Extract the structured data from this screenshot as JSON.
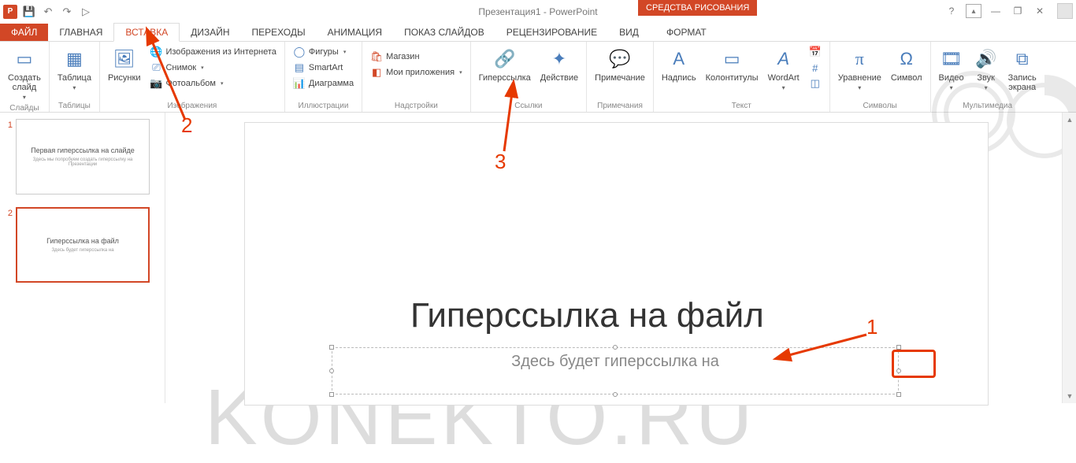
{
  "title": "Презентация1 - PowerPoint",
  "context_tab": "СРЕДСТВА РИСОВАНИЯ",
  "tabs": {
    "file": "ФАЙЛ",
    "home": "ГЛАВНАЯ",
    "insert": "ВСТАВКА",
    "design": "ДИЗАЙН",
    "transitions": "ПЕРЕХОДЫ",
    "animation": "АНИМАЦИЯ",
    "slideshow": "ПОКАЗ СЛАЙДОВ",
    "review": "РЕЦЕНЗИРОВАНИЕ",
    "view": "ВИД",
    "format": "ФОРМАТ"
  },
  "ribbon": {
    "slides": {
      "new_slide": "Создать\nслайд",
      "group": "Слайды"
    },
    "tables": {
      "table": "Таблица",
      "group": "Таблицы"
    },
    "images": {
      "pictures": "Рисунки",
      "online": "Изображения из Интернета",
      "screenshot": "Снимок",
      "album": "Фотоальбом",
      "group": "Изображения"
    },
    "illustrations": {
      "shapes": "Фигуры",
      "smartart": "SmartArt",
      "chart": "Диаграмма",
      "group": "Иллюстрации"
    },
    "addins": {
      "store": "Магазин",
      "myapps": "Мои приложения",
      "group": "Надстройки"
    },
    "links": {
      "hyperlink": "Гиперссылка",
      "action": "Действие",
      "group": "Ссылки"
    },
    "comments": {
      "comment": "Примечание",
      "group": "Примечания"
    },
    "text": {
      "textbox": "Надпись",
      "headerfooter": "Колонтитулы",
      "wordart": "WordArt",
      "group": "Текст"
    },
    "symbols": {
      "equation": "Уравнение",
      "symbol": "Символ",
      "group": "Символы"
    },
    "media": {
      "video": "Видео",
      "audio": "Звук",
      "screen": "Запись\nэкрана",
      "group": "Мультимедиа"
    }
  },
  "thumbs": [
    {
      "num": "1",
      "title": "Первая гиперссылка на слайде",
      "sub": "Здесь мы попробуем создать гиперссылку на Презентации"
    },
    {
      "num": "2",
      "title": "Гиперссылка на файл",
      "sub": "Здесь будет гиперссылка на"
    }
  ],
  "slide": {
    "title": "Гиперссылка на файл",
    "content": "Здесь будет гиперссылка на"
  },
  "watermark": "KONEKTO.RU",
  "anno": {
    "n1": "1",
    "n2": "2",
    "n3": "3"
  }
}
